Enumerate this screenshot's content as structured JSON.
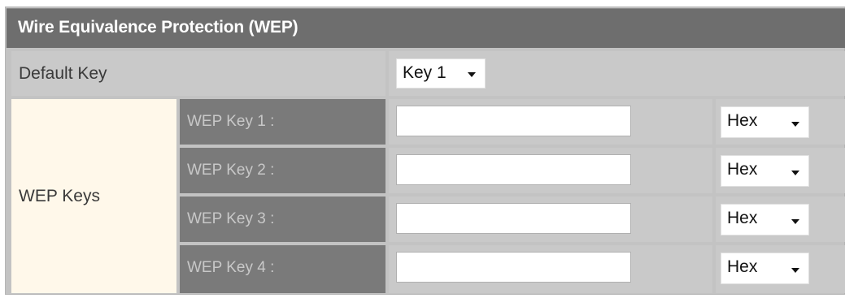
{
  "section": {
    "title": "Wire Equivalence Protection (WEP)"
  },
  "default_key": {
    "label": "Default Key",
    "selected": "Key 1"
  },
  "wep_keys": {
    "group_label": "WEP Keys",
    "keys": [
      {
        "label": "WEP Key 1 :",
        "value": "",
        "format": "Hex"
      },
      {
        "label": "WEP Key 2 :",
        "value": "",
        "format": "Hex"
      },
      {
        "label": "WEP Key 3 :",
        "value": "",
        "format": "Hex"
      },
      {
        "label": "WEP Key 4 :",
        "value": "",
        "format": "Hex"
      }
    ]
  }
}
